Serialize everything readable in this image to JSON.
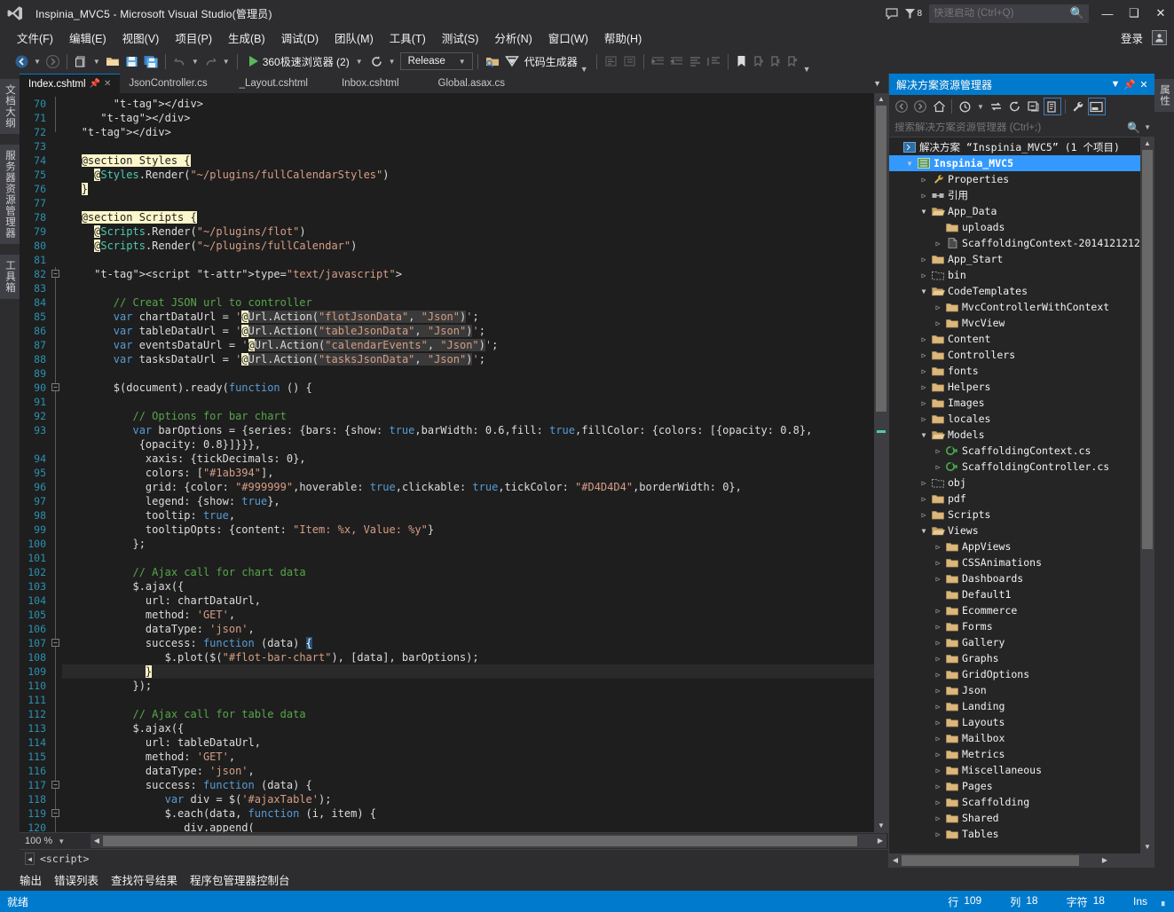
{
  "window": {
    "title": "Inspinia_MVC5 - Microsoft Visual Studio(管理员)",
    "notification_count": "8",
    "quick_launch_placeholder": "快速启动 (Ctrl+Q)",
    "minimize": "—",
    "maximize": "❑",
    "close": "✕"
  },
  "menubar": {
    "items": [
      {
        "label": "文件(F)"
      },
      {
        "label": "编辑(E)"
      },
      {
        "label": "视图(V)"
      },
      {
        "label": "项目(P)"
      },
      {
        "label": "生成(B)"
      },
      {
        "label": "调试(D)"
      },
      {
        "label": "团队(M)"
      },
      {
        "label": "工具(T)"
      },
      {
        "label": "测试(S)"
      },
      {
        "label": "分析(N)"
      },
      {
        "label": "窗口(W)"
      },
      {
        "label": "帮助(H)"
      }
    ],
    "signin": "登录"
  },
  "toolbar": {
    "run_label": "360极速浏览器 (2)",
    "config": "Release",
    "codegen_label": "代码生成器"
  },
  "vertical_tabs_left": [
    "文档大纲",
    "服务器资源管理器",
    "工具箱"
  ],
  "vertical_tabs_right": [
    "属性"
  ],
  "editor": {
    "tabs": [
      {
        "label": "Index.cshtml",
        "active": true
      },
      {
        "label": "JsonController.cs",
        "active": false
      },
      {
        "label": "_Layout.cshtml",
        "active": false
      },
      {
        "label": "Inbox.cshtml",
        "active": false
      },
      {
        "label": "Global.asax.cs",
        "active": false
      }
    ],
    "zoom": "100 %",
    "nav_scope": "<script>",
    "first_line_number": 70,
    "lines": [
      {
        "n": 70,
        "indent": 8,
        "fold": "line",
        "text": "</div>"
      },
      {
        "n": 71,
        "indent": 6,
        "fold": "line",
        "text": "</div>"
      },
      {
        "n": 72,
        "indent": 3,
        "fold": "end",
        "text": "</div>"
      },
      {
        "n": 73,
        "indent": 0,
        "fold": "",
        "text": ""
      },
      {
        "n": 74,
        "indent": 3,
        "fold": "",
        "text": "@section Styles {"
      },
      {
        "n": 75,
        "indent": 5,
        "fold": "",
        "text": "@Styles.Render(\"~/plugins/fullCalendarStyles\")"
      },
      {
        "n": 76,
        "indent": 3,
        "fold": "",
        "text": "}"
      },
      {
        "n": 77,
        "indent": 0,
        "fold": "",
        "text": ""
      },
      {
        "n": 78,
        "indent": 3,
        "fold": "",
        "text": "@section Scripts {"
      },
      {
        "n": 79,
        "indent": 5,
        "fold": "",
        "text": "@Scripts.Render(\"~/plugins/flot\")"
      },
      {
        "n": 80,
        "indent": 5,
        "fold": "",
        "text": "@Scripts.Render(\"~/plugins/fullCalendar\")"
      },
      {
        "n": 81,
        "indent": 0,
        "fold": "",
        "text": ""
      },
      {
        "n": 82,
        "indent": 5,
        "fold": "box",
        "text": "<script type=\"text/javascript\">"
      },
      {
        "n": 83,
        "indent": 0,
        "fold": "line",
        "text": ""
      },
      {
        "n": 84,
        "indent": 8,
        "fold": "line",
        "text": "// Creat JSON url to controller"
      },
      {
        "n": 85,
        "indent": 8,
        "fold": "line",
        "text": "var chartDataUrl = '@Url.Action(\"flotJsonData\", \"Json\")';"
      },
      {
        "n": 86,
        "indent": 8,
        "fold": "line",
        "text": "var tableDataUrl = '@Url.Action(\"tableJsonData\", \"Json\")';"
      },
      {
        "n": 87,
        "indent": 8,
        "fold": "line",
        "text": "var eventsDataUrl = '@Url.Action(\"calendarEvents\", \"Json\")';"
      },
      {
        "n": 88,
        "indent": 8,
        "fold": "line",
        "text": "var tasksDataUrl = '@Url.Action(\"tasksJsonData\", \"Json\")';"
      },
      {
        "n": 89,
        "indent": 0,
        "fold": "line",
        "text": ""
      },
      {
        "n": 90,
        "indent": 8,
        "fold": "box",
        "text": "$(document).ready(function () {"
      },
      {
        "n": 91,
        "indent": 0,
        "fold": "line",
        "text": ""
      },
      {
        "n": 92,
        "indent": 11,
        "fold": "line",
        "text": "// Options for bar chart"
      },
      {
        "n": 93,
        "indent": 11,
        "fold": "line",
        "text": "var barOptions = {series: {bars: {show: true,barWidth: 0.6,fill: true,fillColor: {colors: [{opacity: 0.8},"
      },
      {
        "n": "",
        "indent": 12,
        "fold": "line",
        "text": "{opacity: 0.8}]}}},"
      },
      {
        "n": 94,
        "indent": 13,
        "fold": "line",
        "text": "xaxis: {tickDecimals: 0},"
      },
      {
        "n": 95,
        "indent": 13,
        "fold": "line",
        "text": "colors: [\"#1ab394\"],"
      },
      {
        "n": 96,
        "indent": 13,
        "fold": "line",
        "text": "grid: {color: \"#999999\",hoverable: true,clickable: true,tickColor: \"#D4D4D4\",borderWidth: 0},"
      },
      {
        "n": 97,
        "indent": 13,
        "fold": "line",
        "text": "legend: {show: true},"
      },
      {
        "n": 98,
        "indent": 13,
        "fold": "line",
        "text": "tooltip: true,"
      },
      {
        "n": 99,
        "indent": 13,
        "fold": "line",
        "text": "tooltipOpts: {content: \"Item: %x, Value: %y\"}"
      },
      {
        "n": 100,
        "indent": 11,
        "fold": "line",
        "text": "};"
      },
      {
        "n": 101,
        "indent": 0,
        "fold": "line",
        "text": ""
      },
      {
        "n": 102,
        "indent": 11,
        "fold": "line",
        "text": "// Ajax call for chart data"
      },
      {
        "n": 103,
        "indent": 11,
        "fold": "line",
        "text": "$.ajax({"
      },
      {
        "n": 104,
        "indent": 13,
        "fold": "line",
        "text": "url: chartDataUrl,"
      },
      {
        "n": 105,
        "indent": 13,
        "fold": "line",
        "text": "method: 'GET',"
      },
      {
        "n": 106,
        "indent": 13,
        "fold": "line",
        "text": "dataType: 'json',"
      },
      {
        "n": 107,
        "indent": 13,
        "fold": "box",
        "text": "success: function (data) {"
      },
      {
        "n": 108,
        "indent": 16,
        "fold": "line",
        "text": "$.plot($(\"#flot-bar-chart\"), [data], barOptions);"
      },
      {
        "n": 109,
        "indent": 13,
        "fold": "line",
        "text": "}",
        "selected": true
      },
      {
        "n": 110,
        "indent": 11,
        "fold": "line",
        "text": "});"
      },
      {
        "n": 111,
        "indent": 0,
        "fold": "line",
        "text": ""
      },
      {
        "n": 112,
        "indent": 11,
        "fold": "line",
        "text": "// Ajax call for table data"
      },
      {
        "n": 113,
        "indent": 11,
        "fold": "line",
        "text": "$.ajax({"
      },
      {
        "n": 114,
        "indent": 13,
        "fold": "line",
        "text": "url: tableDataUrl,"
      },
      {
        "n": 115,
        "indent": 13,
        "fold": "line",
        "text": "method: 'GET',"
      },
      {
        "n": 116,
        "indent": 13,
        "fold": "line",
        "text": "dataType: 'json',"
      },
      {
        "n": 117,
        "indent": 13,
        "fold": "box",
        "text": "success: function (data) {"
      },
      {
        "n": 118,
        "indent": 16,
        "fold": "line",
        "text": "var div = $('#ajaxTable');"
      },
      {
        "n": 119,
        "indent": 16,
        "fold": "box",
        "text": "$.each(data, function (i, item) {"
      },
      {
        "n": 120,
        "indent": 19,
        "fold": "line",
        "text": "div.append("
      }
    ]
  },
  "solution_explorer": {
    "title": "解决方案资源管理器",
    "search_placeholder": "搜索解决方案资源管理器 (Ctrl+;)",
    "tree": [
      {
        "depth": 0,
        "exp": "none",
        "icon": "solution",
        "label": "解决方案 “Inspinia_MVC5” (1 个项目)"
      },
      {
        "depth": 1,
        "exp": "open",
        "icon": "project",
        "label": "Inspinia_MVC5",
        "selected": true
      },
      {
        "depth": 2,
        "exp": "closed",
        "icon": "wrench",
        "label": "Properties"
      },
      {
        "depth": 2,
        "exp": "closed",
        "icon": "refs",
        "label": "引用"
      },
      {
        "depth": 2,
        "exp": "open",
        "icon": "folderopen",
        "label": "App_Data"
      },
      {
        "depth": 3,
        "exp": "none",
        "icon": "folder",
        "label": "uploads"
      },
      {
        "depth": 3,
        "exp": "closed",
        "icon": "file",
        "label": "ScaffoldingContext-2014121212"
      },
      {
        "depth": 2,
        "exp": "closed",
        "icon": "folder",
        "label": "App_Start"
      },
      {
        "depth": 2,
        "exp": "closed",
        "icon": "folderbin",
        "label": "bin"
      },
      {
        "depth": 2,
        "exp": "open",
        "icon": "folderopen",
        "label": "CodeTemplates"
      },
      {
        "depth": 3,
        "exp": "closed",
        "icon": "folder",
        "label": "MvcControllerWithContext"
      },
      {
        "depth": 3,
        "exp": "closed",
        "icon": "folder",
        "label": "MvcView"
      },
      {
        "depth": 2,
        "exp": "closed",
        "icon": "folder",
        "label": "Content"
      },
      {
        "depth": 2,
        "exp": "closed",
        "icon": "folder",
        "label": "Controllers"
      },
      {
        "depth": 2,
        "exp": "closed",
        "icon": "folder",
        "label": "fonts"
      },
      {
        "depth": 2,
        "exp": "closed",
        "icon": "folder",
        "label": "Helpers"
      },
      {
        "depth": 2,
        "exp": "closed",
        "icon": "folder",
        "label": "Images"
      },
      {
        "depth": 2,
        "exp": "closed",
        "icon": "folder",
        "label": "locales"
      },
      {
        "depth": 2,
        "exp": "open",
        "icon": "folderopen",
        "label": "Models"
      },
      {
        "depth": 3,
        "exp": "closed",
        "icon": "csharp",
        "label": "ScaffoldingContext.cs"
      },
      {
        "depth": 3,
        "exp": "closed",
        "icon": "csharp",
        "label": "ScaffoldingController.cs"
      },
      {
        "depth": 2,
        "exp": "closed",
        "icon": "folderbin",
        "label": "obj"
      },
      {
        "depth": 2,
        "exp": "closed",
        "icon": "folder",
        "label": "pdf"
      },
      {
        "depth": 2,
        "exp": "closed",
        "icon": "folder",
        "label": "Scripts"
      },
      {
        "depth": 2,
        "exp": "open",
        "icon": "folderopen",
        "label": "Views"
      },
      {
        "depth": 3,
        "exp": "closed",
        "icon": "folder",
        "label": "AppViews"
      },
      {
        "depth": 3,
        "exp": "closed",
        "icon": "folder",
        "label": "CSSAnimations"
      },
      {
        "depth": 3,
        "exp": "closed",
        "icon": "folder",
        "label": "Dashboards"
      },
      {
        "depth": 3,
        "exp": "none",
        "icon": "folder",
        "label": "Default1"
      },
      {
        "depth": 3,
        "exp": "closed",
        "icon": "folder",
        "label": "Ecommerce"
      },
      {
        "depth": 3,
        "exp": "closed",
        "icon": "folder",
        "label": "Forms"
      },
      {
        "depth": 3,
        "exp": "closed",
        "icon": "folder",
        "label": "Gallery"
      },
      {
        "depth": 3,
        "exp": "closed",
        "icon": "folder",
        "label": "Graphs"
      },
      {
        "depth": 3,
        "exp": "closed",
        "icon": "folder",
        "label": "GridOptions"
      },
      {
        "depth": 3,
        "exp": "closed",
        "icon": "folder",
        "label": "Json"
      },
      {
        "depth": 3,
        "exp": "closed",
        "icon": "folder",
        "label": "Landing"
      },
      {
        "depth": 3,
        "exp": "closed",
        "icon": "folder",
        "label": "Layouts"
      },
      {
        "depth": 3,
        "exp": "closed",
        "icon": "folder",
        "label": "Mailbox"
      },
      {
        "depth": 3,
        "exp": "closed",
        "icon": "folder",
        "label": "Metrics"
      },
      {
        "depth": 3,
        "exp": "closed",
        "icon": "folder",
        "label": "Miscellaneous"
      },
      {
        "depth": 3,
        "exp": "closed",
        "icon": "folder",
        "label": "Pages"
      },
      {
        "depth": 3,
        "exp": "closed",
        "icon": "folder",
        "label": "Scaffolding"
      },
      {
        "depth": 3,
        "exp": "closed",
        "icon": "folder",
        "label": "Shared"
      },
      {
        "depth": 3,
        "exp": "closed",
        "icon": "folder",
        "label": "Tables"
      }
    ]
  },
  "bottom_tabs": [
    "输出",
    "错误列表",
    "查找符号结果",
    "程序包管理器控制台"
  ],
  "statusbar": {
    "state": "就绪",
    "line_label": "行",
    "line_value": "109",
    "col_label": "列",
    "col_value": "18",
    "char_label": "字符",
    "char_value": "18",
    "insert_mode": "Ins"
  },
  "colors": {
    "accent": "#007acc",
    "window_bg": "#2d2d30",
    "editor_bg": "#1e1e1e",
    "selection": "#3399ff"
  }
}
